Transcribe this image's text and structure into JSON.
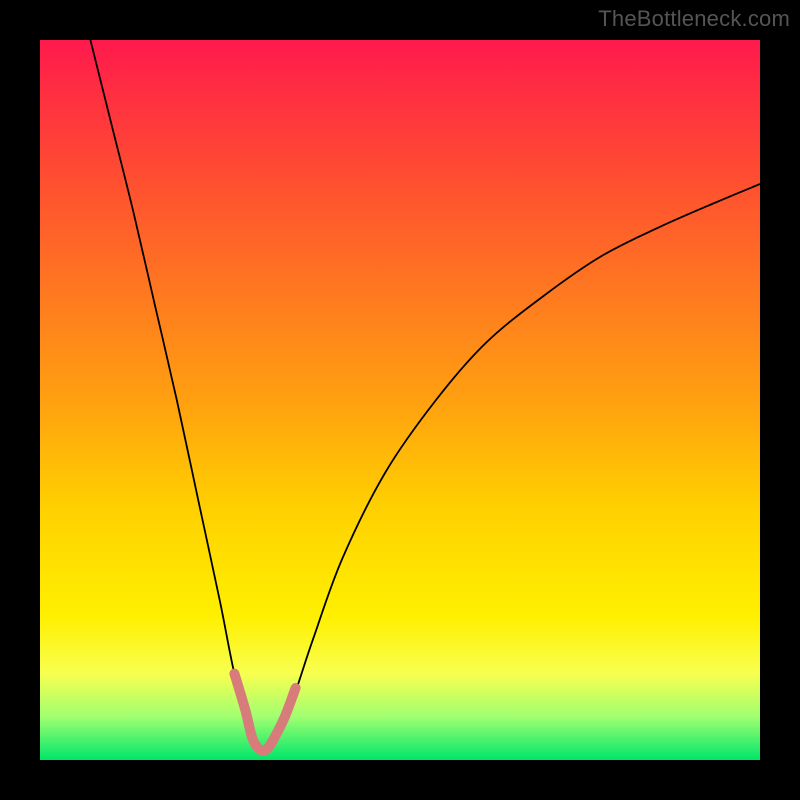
{
  "watermark": "TheBottleneck.com",
  "chart_data": {
    "type": "line",
    "title": "",
    "xlabel": "",
    "ylabel": "",
    "xlim": [
      0,
      100
    ],
    "ylim": [
      0,
      100
    ],
    "background_gradient_stops": [
      {
        "pos": 0,
        "color": "#ff1a4d"
      },
      {
        "pos": 8,
        "color": "#ff3040"
      },
      {
        "pos": 20,
        "color": "#ff5030"
      },
      {
        "pos": 35,
        "color": "#ff7820"
      },
      {
        "pos": 50,
        "color": "#ffa010"
      },
      {
        "pos": 65,
        "color": "#ffd000"
      },
      {
        "pos": 80,
        "color": "#fff000"
      },
      {
        "pos": 88,
        "color": "#f8ff50"
      },
      {
        "pos": 94,
        "color": "#a0ff70"
      },
      {
        "pos": 100,
        "color": "#00e66a"
      }
    ],
    "series": [
      {
        "name": "bottleneck-curve",
        "color": "#000000",
        "width": 1.8,
        "x": [
          7,
          10,
          13,
          16,
          19,
          22,
          25,
          27,
          29,
          30.5,
          32,
          34,
          36,
          38,
          42,
          48,
          55,
          62,
          70,
          78,
          86,
          94,
          100
        ],
        "values": [
          100,
          88,
          76,
          63,
          50,
          36,
          22,
          12,
          5,
          1.5,
          1.5,
          5,
          11,
          17,
          28,
          40,
          50,
          58,
          64.5,
          70,
          74,
          77.5,
          80
        ]
      },
      {
        "name": "highlight-min",
        "color": "#d77b7b",
        "width": 10,
        "cap": "round",
        "x": [
          27,
          28.5,
          29.5,
          30.5,
          31.5,
          32.5,
          34,
          35.5
        ],
        "values": [
          12,
          7,
          3,
          1.5,
          1.5,
          3,
          6,
          10
        ]
      }
    ]
  }
}
